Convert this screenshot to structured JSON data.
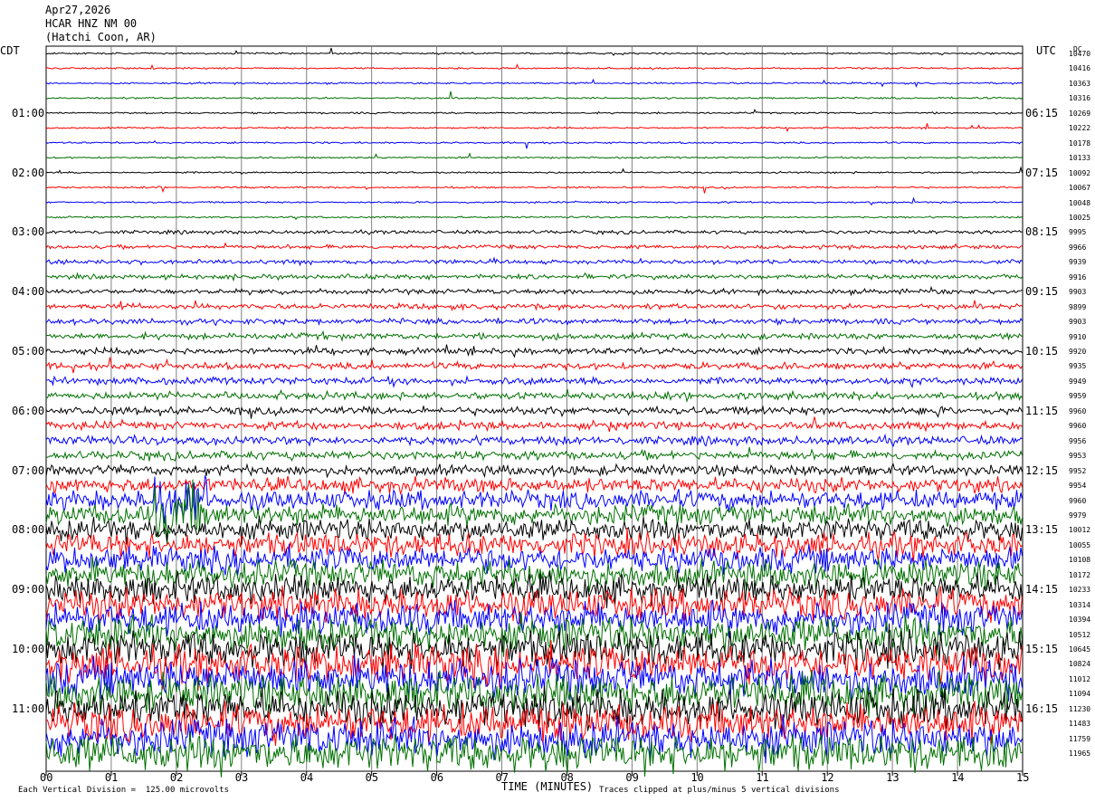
{
  "header": {
    "date": "Apr27,2026",
    "station": "HCAR HNZ NM 00",
    "location": "(Hatchi Coon, AR)"
  },
  "left_zone_label": "CDT",
  "right_zone_label": "UTC",
  "dc_header": "DC",
  "chart_data": {
    "type": "line",
    "title": "",
    "xlabel": "TIME (MINUTES)",
    "x_ticks": [
      "00",
      "01",
      "02",
      "03",
      "04",
      "05",
      "06",
      "07",
      "08",
      "09",
      "10",
      "11",
      "12",
      "13",
      "14",
      "15"
    ],
    "xlim": [
      0,
      15
    ],
    "left_time_labels": [
      "01:00",
      "02:00",
      "03:00",
      "04:00",
      "05:00",
      "06:00",
      "07:00",
      "08:00",
      "09:00",
      "10:00",
      "11:00"
    ],
    "right_time_labels": [
      "06:15",
      "07:15",
      "08:15",
      "09:15",
      "10:15",
      "11:15",
      "12:15",
      "13:15",
      "14:15",
      "15:15",
      "16:15"
    ],
    "dc_offsets": [
      "10470",
      "10416",
      "10363",
      "10316",
      "10269",
      "10222",
      "10178",
      "10133",
      "10092",
      "10067",
      "10048",
      "10025",
      "9995",
      "9966",
      "9939",
      "9916",
      "9903",
      "9899",
      "9903",
      "9910",
      "9920",
      "9935",
      "9949",
      "9959",
      "9960",
      "9960",
      "9956",
      "9953",
      "9952",
      "9954",
      "9960",
      "9979",
      "10012",
      "10055",
      "10108",
      "10172",
      "10233",
      "10314",
      "10394",
      "10512",
      "10645",
      "10824",
      "11012",
      "11094",
      "11230",
      "11483",
      "11759",
      "11965"
    ],
    "trace_colors": [
      "#000000",
      "#ff0000",
      "#0000ff",
      "#007000"
    ],
    "trace_rows": 48,
    "minutes_per_row": 15,
    "footer_left": "Each Vertical Division =  125.00 microvolts",
    "footer_right": "Traces clipped at plus/minus 5 vertical divisions"
  }
}
